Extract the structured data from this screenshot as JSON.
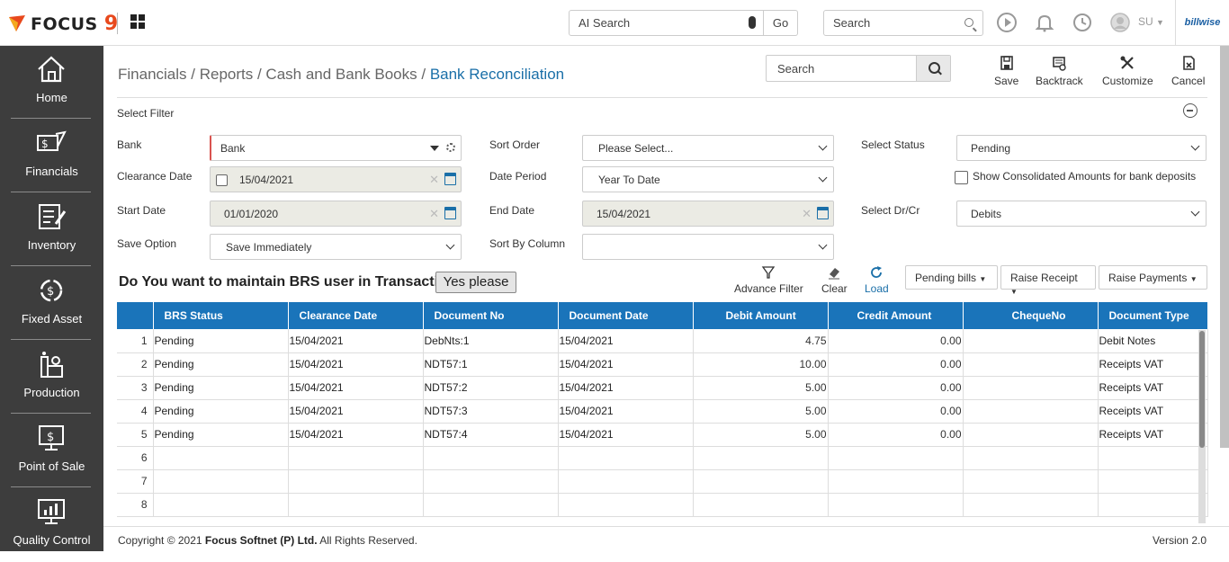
{
  "app": {
    "logo_text": "FOCUS",
    "logo_nine": "9"
  },
  "topbar": {
    "ai_search_placeholder": "AI Search",
    "go_label": "Go",
    "search_placeholder": "Search",
    "user_initials": "SU",
    "billwise_label": "billwise"
  },
  "sidebar": {
    "items": [
      {
        "label": "Home",
        "icon": "home-icon"
      },
      {
        "label": "Financials",
        "icon": "financials-icon"
      },
      {
        "label": "Inventory",
        "icon": "inventory-icon"
      },
      {
        "label": "Fixed Asset",
        "icon": "fixed-asset-icon"
      },
      {
        "label": "Production",
        "icon": "production-icon"
      },
      {
        "label": "Point of Sale",
        "icon": "pos-icon"
      },
      {
        "label": "Quality Control",
        "icon": "quality-control-icon"
      }
    ]
  },
  "breadcrumb": {
    "items": [
      "Financials",
      "Reports",
      "Cash and Bank Books"
    ],
    "current": "Bank Reconciliation"
  },
  "toolbar": {
    "search_placeholder": "Search",
    "save": "Save",
    "backtrack": "Backtrack",
    "customize": "Customize",
    "cancel": "Cancel"
  },
  "filter": {
    "title": "Select Filter",
    "bank_label": "Bank",
    "bank_value": "Bank",
    "clearance_date_label": "Clearance Date",
    "clearance_date_value": "15/04/2021",
    "start_date_label": "Start Date",
    "start_date_value": "01/01/2020",
    "save_option_label": "Save Option",
    "save_option_value": "Save Immediately",
    "sort_order_label": "Sort Order",
    "sort_order_value": "Please Select...",
    "date_period_label": "Date Period",
    "date_period_value": "Year To Date",
    "end_date_label": "End Date",
    "end_date_value": "15/04/2021",
    "sort_by_column_label": "Sort By Column",
    "sort_by_column_value": "",
    "select_status_label": "Select Status",
    "select_status_value": "Pending",
    "consolidated_label": "Show Consolidated Amounts for bank deposits",
    "select_drcr_label": "Select Dr/Cr",
    "select_drcr_value": "Debits"
  },
  "actions": {
    "brs_question": "Do You want to maintain BRS user in Transaction?",
    "yes_please": "Yes please",
    "advance_filter": "Advance Filter",
    "clear": "Clear",
    "load": "Load",
    "pending_bills": "Pending bills",
    "raise_receipt": "Raise Receipt",
    "raise_payments": "Raise Payments"
  },
  "table": {
    "headers": [
      "BRS Status",
      "Clearance Date",
      "Document No",
      "Document Date",
      "Debit Amount",
      "Credit Amount",
      "ChequeNo",
      "Document Type"
    ],
    "rows": [
      {
        "n": "1",
        "status": "Pending",
        "clearance": "15/04/2021",
        "doc_no": "DebNts:1",
        "doc_date": "15/04/2021",
        "debit": "4.75",
        "credit": "0.00",
        "cheque": "",
        "type": "Debit Notes"
      },
      {
        "n": "2",
        "status": "Pending",
        "clearance": "15/04/2021",
        "doc_no": "NDT57:1",
        "doc_date": "15/04/2021",
        "debit": "10.00",
        "credit": "0.00",
        "cheque": "",
        "type": "Receipts VAT"
      },
      {
        "n": "3",
        "status": "Pending",
        "clearance": "15/04/2021",
        "doc_no": "NDT57:2",
        "doc_date": "15/04/2021",
        "debit": "5.00",
        "credit": "0.00",
        "cheque": "",
        "type": "Receipts VAT"
      },
      {
        "n": "4",
        "status": "Pending",
        "clearance": "15/04/2021",
        "doc_no": "NDT57:3",
        "doc_date": "15/04/2021",
        "debit": "5.00",
        "credit": "0.00",
        "cheque": "",
        "type": "Receipts VAT"
      },
      {
        "n": "5",
        "status": "Pending",
        "clearance": "15/04/2021",
        "doc_no": "NDT57:4",
        "doc_date": "15/04/2021",
        "debit": "5.00",
        "credit": "0.00",
        "cheque": "",
        "type": "Receipts VAT"
      },
      {
        "n": "6",
        "status": "",
        "clearance": "",
        "doc_no": "",
        "doc_date": "",
        "debit": "",
        "credit": "",
        "cheque": "",
        "type": ""
      },
      {
        "n": "7",
        "status": "",
        "clearance": "",
        "doc_no": "",
        "doc_date": "",
        "debit": "",
        "credit": "",
        "cheque": "",
        "type": ""
      },
      {
        "n": "8",
        "status": "",
        "clearance": "",
        "doc_no": "",
        "doc_date": "",
        "debit": "",
        "credit": "",
        "cheque": "",
        "type": ""
      }
    ]
  },
  "footer": {
    "copyright_prefix": "Copyright © 2021",
    "company": "Focus Softnet (P) Ltd.",
    "rights": "All Rights Reserved.",
    "version": "Version 2.0"
  },
  "colors": {
    "accent": "#1a74ba",
    "sidebar": "#3d3d3d",
    "logo_orange": "#e8491d"
  }
}
